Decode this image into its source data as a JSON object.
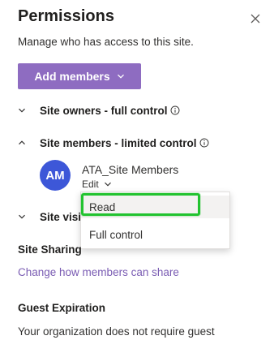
{
  "panel": {
    "title": "Permissions",
    "subtitle": "Manage who has access to this site.",
    "add_members_label": "Add members"
  },
  "groups": [
    {
      "label": "Site owners - full control",
      "expanded": false
    },
    {
      "label": "Site members - limited control",
      "expanded": true
    },
    {
      "label": "Site visit",
      "expanded": false
    }
  ],
  "member": {
    "initials": "AM",
    "name": "ATA_Site Members",
    "edit_label": "Edit"
  },
  "permission_menu": {
    "options": [
      "Read",
      "Full control"
    ],
    "highlighted": "Read"
  },
  "site_sharing": {
    "title": "Site Sharing",
    "link": "Change how members can share"
  },
  "guest_expiration": {
    "title": "Guest Expiration",
    "text": "Your organization does not require guest"
  },
  "colors": {
    "accent": "#8e6cc1",
    "avatar": "#3d57d8",
    "highlight": "#22c330",
    "link": "#7a5cb3"
  },
  "icons": [
    "close-icon",
    "chevron-down-icon",
    "chevron-up-icon",
    "info-icon"
  ]
}
